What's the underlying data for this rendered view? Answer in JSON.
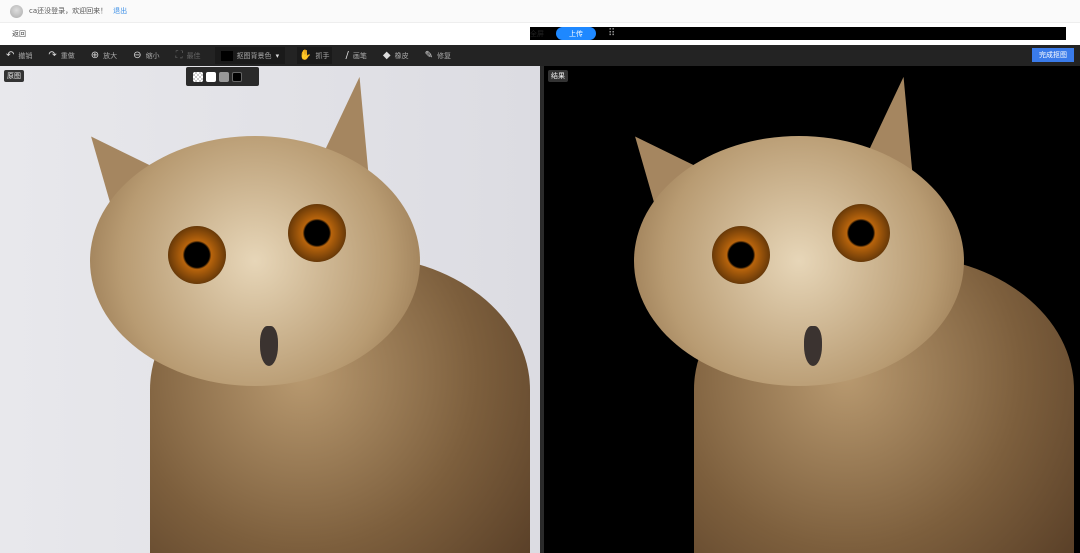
{
  "header": {
    "greeting": "ca还没登录，欢迎回来！",
    "logout": "退出"
  },
  "nav": {
    "back": "返回",
    "fullscreen": "全屏",
    "upload": "上传"
  },
  "toolbar": {
    "undo": "撤销",
    "redo": "重做",
    "zoom_in": "放大",
    "zoom_out": "缩小",
    "best_fit": "最佳",
    "bg_color": "抠图背景色",
    "hand": "抓手",
    "brush": "画笔",
    "eraser": "橡皮",
    "repair": "修复",
    "done": "完成抠图"
  },
  "panes": {
    "original": "原图",
    "result": "结果"
  },
  "bg_options": [
    "transparent",
    "#ffffff",
    "#999999",
    "#000000"
  ]
}
